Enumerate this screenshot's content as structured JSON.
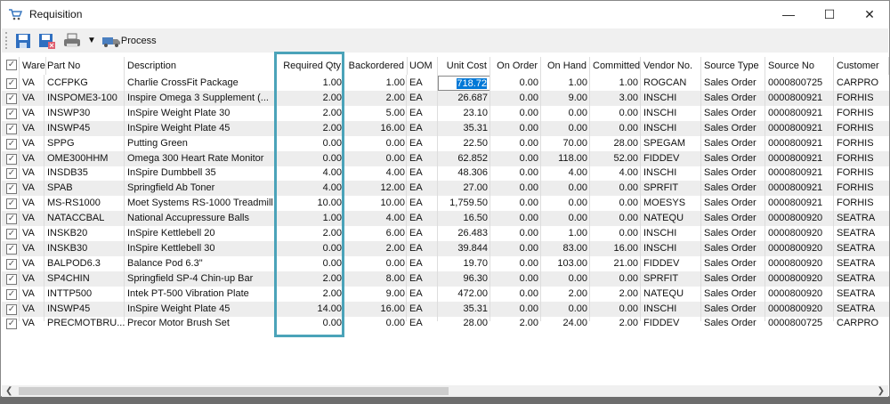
{
  "window": {
    "title": "Requisition",
    "minimize": "—",
    "maximize": "☐",
    "close": "✕"
  },
  "toolbar": {
    "process_label": "Process"
  },
  "columns": [
    "",
    "Ware",
    "Part No",
    "Description",
    "Required Qty",
    "Backordered",
    "UOM",
    "Unit Cost",
    "On Order",
    "On Hand",
    "Committed",
    "Vendor No.",
    "Source Type",
    "Source No",
    "Customer"
  ],
  "rows": [
    [
      "VA",
      "CCFPKG",
      "Charlie CrossFit Package",
      "1.00",
      "1.00",
      "EA",
      "718.72",
      "0.00",
      "1.00",
      "1.00",
      "ROGCAN",
      "Sales Order",
      "0000800725",
      "CARPRO"
    ],
    [
      "VA",
      "INSPOME3-100",
      "Inspire Omega 3 Supplement  (...",
      "2.00",
      "2.00",
      "EA",
      "26.687",
      "0.00",
      "9.00",
      "3.00",
      "INSCHI",
      "Sales Order",
      "0000800921",
      "FORHIS"
    ],
    [
      "VA",
      "INSWP30",
      "InSpire Weight Plate 30",
      "2.00",
      "5.00",
      "EA",
      "23.10",
      "0.00",
      "0.00",
      "0.00",
      "INSCHI",
      "Sales Order",
      "0000800921",
      "FORHIS"
    ],
    [
      "VA",
      "INSWP45",
      "InSpire Weight Plate 45",
      "2.00",
      "16.00",
      "EA",
      "35.31",
      "0.00",
      "0.00",
      "0.00",
      "INSCHI",
      "Sales Order",
      "0000800921",
      "FORHIS"
    ],
    [
      "VA",
      "SPPG",
      "Putting Green",
      "0.00",
      "0.00",
      "EA",
      "22.50",
      "0.00",
      "70.00",
      "28.00",
      "SPEGAM",
      "Sales Order",
      "0000800921",
      "FORHIS"
    ],
    [
      "VA",
      "OME300HHM",
      "Omega 300 Heart Rate Monitor",
      "0.00",
      "0.00",
      "EA",
      "62.852",
      "0.00",
      "118.00",
      "52.00",
      "FIDDEV",
      "Sales Order",
      "0000800921",
      "FORHIS"
    ],
    [
      "VA",
      "INSDB35",
      "InSpire Dumbbell 35",
      "4.00",
      "4.00",
      "EA",
      "48.306",
      "0.00",
      "4.00",
      "4.00",
      "INSCHI",
      "Sales Order",
      "0000800921",
      "FORHIS"
    ],
    [
      "VA",
      "SPAB",
      "Springfield Ab Toner",
      "4.00",
      "12.00",
      "EA",
      "27.00",
      "0.00",
      "0.00",
      "0.00",
      "SPRFIT",
      "Sales Order",
      "0000800921",
      "FORHIS"
    ],
    [
      "VA",
      "MS-RS1000",
      "Moet Systems RS-1000 Treadmill",
      "10.00",
      "10.00",
      "EA",
      "1,759.50",
      "0.00",
      "0.00",
      "0.00",
      "MOESYS",
      "Sales Order",
      "0000800921",
      "FORHIS"
    ],
    [
      "VA",
      "NATACCBAL",
      "National Accupressure Balls",
      "1.00",
      "4.00",
      "EA",
      "16.50",
      "0.00",
      "0.00",
      "0.00",
      "NATEQU",
      "Sales Order",
      "0000800920",
      "SEATRA"
    ],
    [
      "VA",
      "INSKB20",
      "InSpire Kettlebell 20",
      "2.00",
      "6.00",
      "EA",
      "26.483",
      "0.00",
      "1.00",
      "0.00",
      "INSCHI",
      "Sales Order",
      "0000800920",
      "SEATRA"
    ],
    [
      "VA",
      "INSKB30",
      "InSpire Kettlebell 30",
      "0.00",
      "2.00",
      "EA",
      "39.844",
      "0.00",
      "83.00",
      "16.00",
      "INSCHI",
      "Sales Order",
      "0000800920",
      "SEATRA"
    ],
    [
      "VA",
      "BALPOD6.3",
      "Balance Pod 6.3\"",
      "0.00",
      "0.00",
      "EA",
      "19.70",
      "0.00",
      "103.00",
      "21.00",
      "FIDDEV",
      "Sales Order",
      "0000800920",
      "SEATRA"
    ],
    [
      "VA",
      "SP4CHIN",
      "Springfield SP-4 Chin-up Bar",
      "2.00",
      "8.00",
      "EA",
      "96.30",
      "0.00",
      "0.00",
      "0.00",
      "SPRFIT",
      "Sales Order",
      "0000800920",
      "SEATRA"
    ],
    [
      "VA",
      "INTTP500",
      "Intek PT-500 Vibration Plate",
      "2.00",
      "9.00",
      "EA",
      "472.00",
      "0.00",
      "2.00",
      "2.00",
      "NATEQU",
      "Sales Order",
      "0000800920",
      "SEATRA"
    ],
    [
      "VA",
      "INSWP45",
      "InSpire Weight Plate 45",
      "14.00",
      "16.00",
      "EA",
      "35.31",
      "0.00",
      "0.00",
      "0.00",
      "INSCHI",
      "Sales Order",
      "0000800920",
      "SEATRA"
    ],
    [
      "VA",
      "PRECMOTBRU...",
      "Precor Motor Brush Set",
      "0.00",
      "0.00",
      "EA",
      "28.00",
      "2.00",
      "24.00",
      "2.00",
      "FIDDEV",
      "Sales Order",
      "0000800725",
      "CARPRO"
    ]
  ],
  "colors": {
    "highlight": "#4ba3b9",
    "selection": "#0078d7"
  }
}
